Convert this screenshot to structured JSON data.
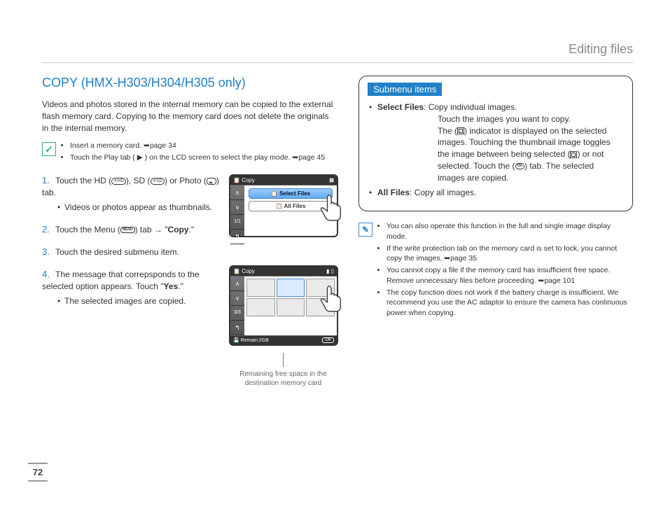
{
  "header": {
    "category": "Editing files"
  },
  "page_number": "72",
  "left": {
    "title": "COPY (HMX-H303/H304/H305 only)",
    "intro": "Videos and photos stored in the internal memory can be copied to the external flash memory card. Copying to the memory card does not delete the originals in the internal memory.",
    "top_notes": [
      "Insert a memory card. ➥page 34",
      "Touch the Play tab ( ▶ ) on the LCD screen to select the play mode. ➥page 45"
    ],
    "steps": {
      "s1": {
        "main_a": "Touch the HD (",
        "hd": "⦿HD",
        "main_b": "), SD (",
        "sd": "⦿SD",
        "main_c": ") or Photo (",
        "main_d": ") tab.",
        "sub": "Videos or photos appear as thumbnails."
      },
      "s2": {
        "main_a": "Touch the Menu (",
        "menu": "MENU",
        "main_b": ") tab → \"",
        "bold": "Copy",
        "main_c": ".\""
      },
      "s3": {
        "main": "Touch the desired submenu item."
      },
      "s4": {
        "main_a": "The message that correpsponds to the selected option appears. Touch \"",
        "bold": "Yes",
        "main_b": ".\"",
        "sub": "The selected images are copied."
      }
    },
    "lcd1": {
      "title": "Copy",
      "page": "1/1",
      "opt1": "Select Files",
      "opt2": "All Files"
    },
    "lcd2": {
      "title": "Copy",
      "page": "3/3",
      "remain": "Remain:2GB",
      "ok": "OK"
    },
    "caption": "Remaining free space in the destination memory card"
  },
  "right": {
    "box_title": "Submenu items",
    "select_files_label": "Select Files",
    "select_files_text": ": Copy individual images.",
    "select_files_lines": [
      "Touch the images you want to copy.",
      "The ( ) indicator is displayed on the selected images. Touching the thumbnail image toggles the image between being selected ( ) or not selected. Touch the (  OK  ) tab. The selected images are copied."
    ],
    "all_files_label": "All Files",
    "all_files_text": ": Copy all images.",
    "notes": [
      "You can also operate this function in the full and single image display mode.",
      "If the write protection tab on the memory card is set to lock, you cannot copy the images. ➥page 35",
      "You cannot copy a file if the memory card has insufficient free space. Remove unnecessary files before proceeding. ➥page 101",
      "The copy function does not work if the battery charge is insufficient. We recommend you use the AC adaptor to ensure the camera has continuous power when copying."
    ]
  }
}
